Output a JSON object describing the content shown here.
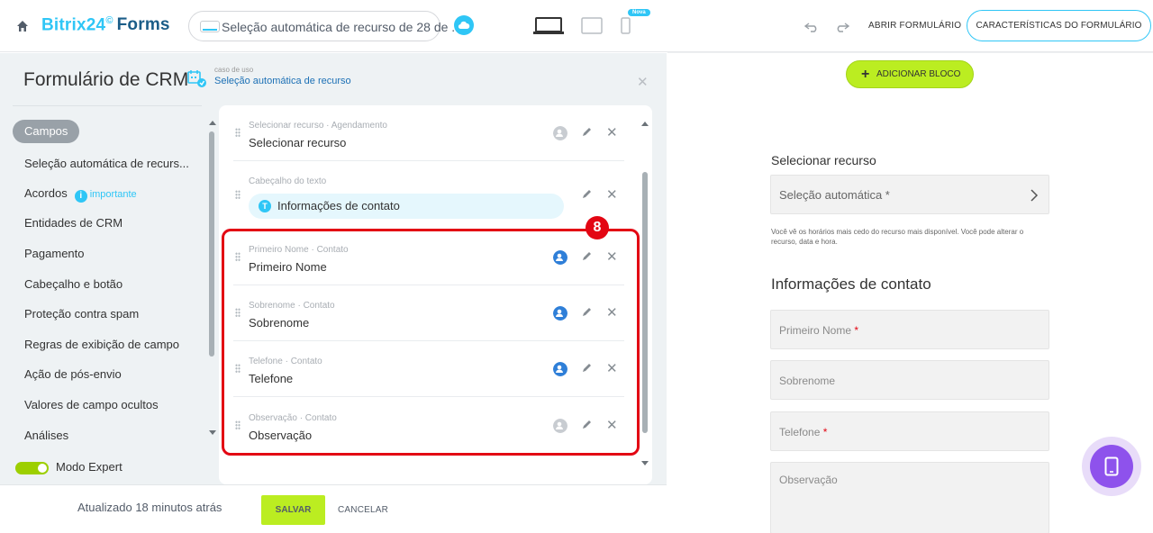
{
  "topbar": {
    "logo_main": "Bitrix24",
    "logo_sup": "©",
    "logo_forms": "Forms",
    "form_title": "Seleção automática de recurso de 28 de ...",
    "nova_badge": "Nova",
    "open_form": "ABRIR FORMULÁRIO",
    "form_properties": "CARACTERÍSTICAS DO FORMULÁRIO"
  },
  "panel": {
    "title": "Formulário de CRM",
    "usecase_caption": "caso de uso",
    "usecase_link": "Seleção automática de recurso"
  },
  "nav": {
    "items": [
      {
        "label": "Campos"
      },
      {
        "label": "Seleção automática de recurs..."
      },
      {
        "label": "Acordos",
        "badge": "i",
        "badge_text": "importante"
      },
      {
        "label": "Entidades de CRM"
      },
      {
        "label": "Pagamento"
      },
      {
        "label": "Cabeçalho e botão"
      },
      {
        "label": "Proteção contra spam"
      },
      {
        "label": "Regras de exibição de campo"
      },
      {
        "label": "Ação de pós-envio"
      },
      {
        "label": "Valores de campo ocultos"
      },
      {
        "label": "Análises"
      }
    ],
    "expert_mode": "Modo Expert"
  },
  "fields": [
    {
      "sub": "Selecionar recurso · Agendamento",
      "main": "Selecionar recurso",
      "crm_active": false
    },
    {
      "sub": "Cabeçalho do texto",
      "chip_badge": "T",
      "main": "Informações de contato"
    },
    {
      "sub": "Primeiro Nome · Contato",
      "main": "Primeiro Nome",
      "crm_active": true
    },
    {
      "sub": "Sobrenome · Contato",
      "main": "Sobrenome",
      "crm_active": true
    },
    {
      "sub": "Telefone · Contato",
      "main": "Telefone",
      "crm_active": true
    },
    {
      "sub": "Observação · Contato",
      "main": "Observação",
      "crm_active": false
    }
  ],
  "annotation": {
    "step": "8"
  },
  "footer": {
    "updated": "Atualizado 18 minutos atrás",
    "save": "SALVAR",
    "cancel": "CANCELAR"
  },
  "preview": {
    "add_block": "ADICIONAR BLOCO",
    "resource_title": "Selecionar recurso",
    "resource_select": "Seleção automática *",
    "resource_note": "Você vê os horários mais cedo do recurso mais disponível. Você pode alterar o recurso, data e hora.",
    "contact_title": "Informações de contato",
    "fields": [
      {
        "label": "Primeiro Nome",
        "required": "*"
      },
      {
        "label": "Sobrenome",
        "required": ""
      },
      {
        "label": "Telefone",
        "required": "*"
      },
      {
        "label": "Observação",
        "required": ""
      }
    ]
  },
  "colors": {
    "accent": "#2fc6f6",
    "save_green": "#bbed21",
    "highlight_red": "#e30613",
    "mobile_purple": "#8e52ec"
  },
  "icons": [
    "home-icon",
    "cloud-icon",
    "laptop-icon",
    "tablet-icon",
    "phone-icon",
    "undo-icon",
    "redo-icon",
    "usecase-icon",
    "close-icon",
    "drag-handle-icon",
    "crm-link-icon",
    "edit-icon",
    "chevron-right-icon",
    "mobile-preview-icon"
  ]
}
